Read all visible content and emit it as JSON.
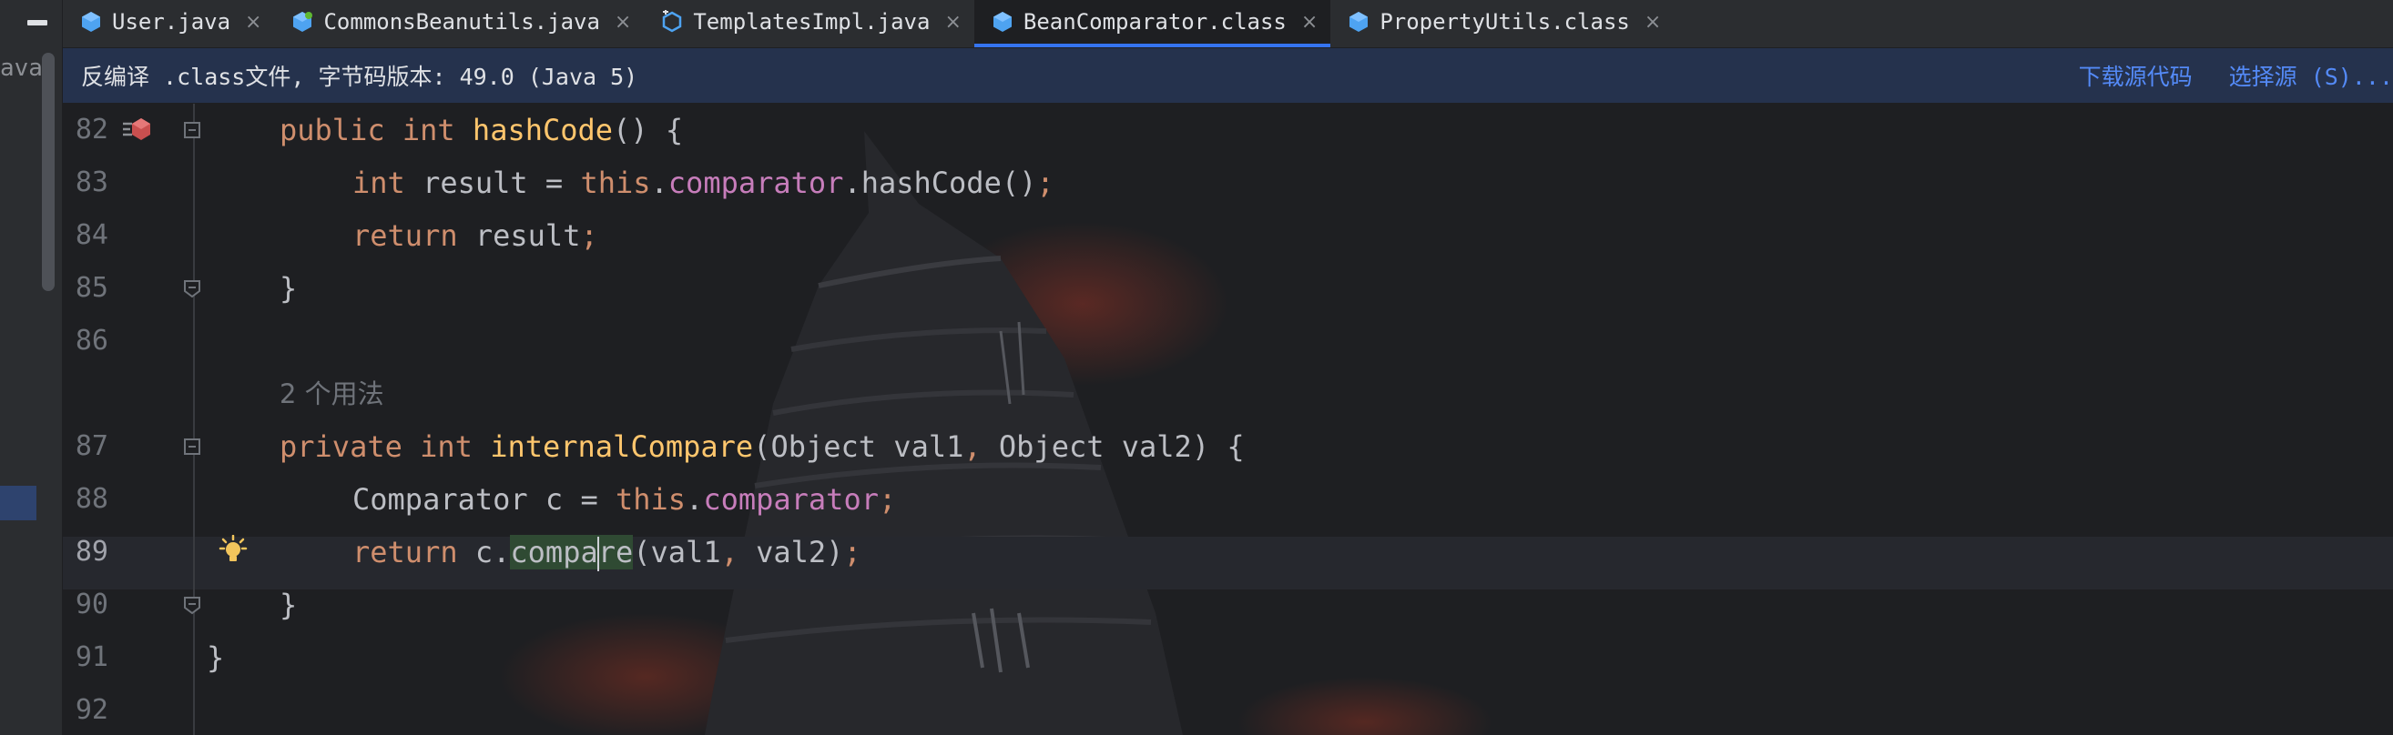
{
  "tabs": [
    {
      "label": "User.java",
      "icon": "java-class-icon",
      "active": false
    },
    {
      "label": "CommonsBeanutils.java",
      "icon": "java-class-icon",
      "active": false
    },
    {
      "label": "TemplatesImpl.java",
      "icon": "java-class-modified-icon",
      "active": false
    },
    {
      "label": "BeanComparator.class",
      "icon": "compiled-class-icon",
      "active": true
    },
    {
      "label": "PropertyUtils.class",
      "icon": "compiled-class-icon",
      "active": false
    }
  ],
  "tab_close_glyph": "×",
  "left_strip": {
    "cut_text": "ava"
  },
  "banner": {
    "text": "反编译 .class文件, 字节码版本: 49.0 (Java 5)",
    "download_link": "下载源代码",
    "choose_source_link": "选择源 (S)..."
  },
  "editor": {
    "lines": [
      {
        "number": "82"
      },
      {
        "number": "83"
      },
      {
        "number": "84"
      },
      {
        "number": "85"
      },
      {
        "number": "86"
      },
      {
        "number": "87"
      },
      {
        "number": "88"
      },
      {
        "number": "89"
      },
      {
        "number": "90"
      },
      {
        "number": "91"
      },
      {
        "number": "92"
      }
    ],
    "code": {
      "l82": {
        "kw1": "public",
        "kw2": "int",
        "name": "hashCode",
        "rest": "() {"
      },
      "l83": {
        "kw1": "int",
        "mid": " result = ",
        "kw2": "this",
        "dot": ".",
        "field": "comparator",
        "rest": ".hashCode()",
        "semi": ";"
      },
      "l84": {
        "kw": "return",
        "rest": " result",
        "semi": ";"
      },
      "l85": {
        "text": "}"
      },
      "inlay": "2 个用法",
      "l87": {
        "kw1": "private",
        "kw2": "int",
        "name": "internalCompare",
        "p1": "(Object val1",
        "comma": ",",
        "p2": " Object val2) {"
      },
      "l88": {
        "type": "Comparator c = ",
        "kw": "this",
        "dot": ".",
        "field": "comparator",
        "semi": ";"
      },
      "l89": {
        "kw": "return",
        "pre": " c.",
        "hl1": "compa",
        "hl2": "re",
        "args1": "(val1",
        "comma": ",",
        "args2": " val2)",
        "semi": ";"
      },
      "l90": {
        "text": "}"
      },
      "l91": {
        "text": "}"
      }
    }
  },
  "colors": {
    "background": "#1e1f22",
    "keyword": "#cf8e6d",
    "method_decl": "#ffc66d",
    "field": "#c77dbb",
    "accent": "#3574f0",
    "link": "#548af7"
  }
}
